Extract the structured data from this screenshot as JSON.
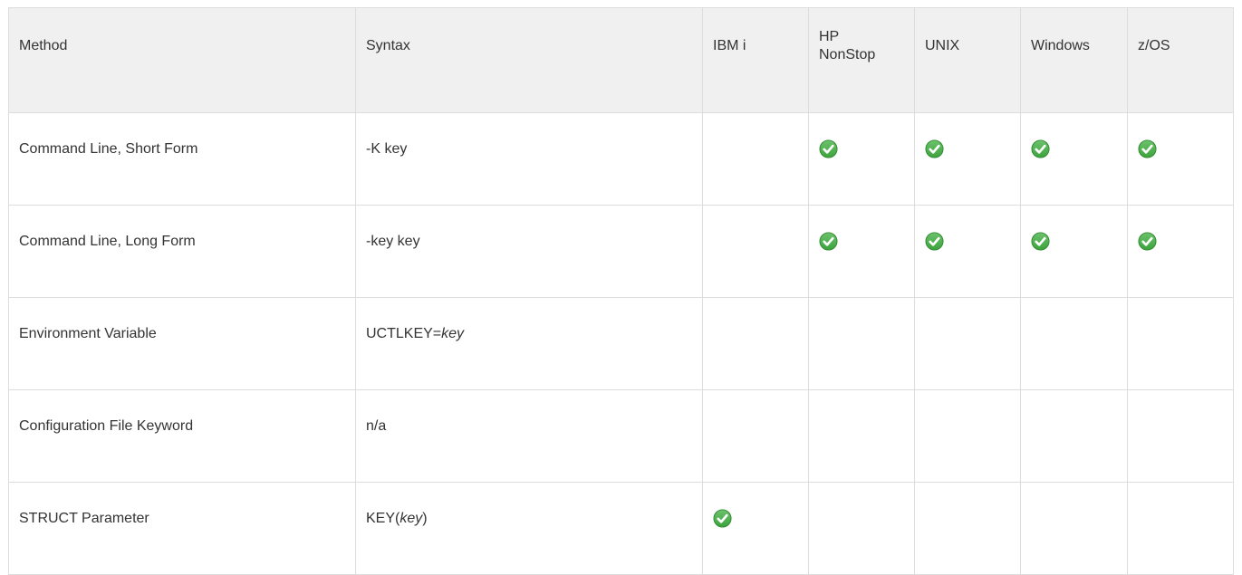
{
  "table": {
    "headers": [
      "Method",
      "Syntax",
      "IBM i",
      "HP NonStop",
      "UNIX",
      "Windows",
      "z/OS"
    ],
    "header_hp_line1": "HP",
    "header_hp_line2": "NonStop",
    "rows": [
      {
        "method": "Command Line, Short Form",
        "syntax_pre": "-K key",
        "syntax_em": "",
        "syntax_post": "",
        "support": [
          false,
          true,
          true,
          true,
          true
        ]
      },
      {
        "method": "Command Line, Long Form",
        "syntax_pre": "-key key",
        "syntax_em": "",
        "syntax_post": "",
        "support": [
          false,
          true,
          true,
          true,
          true
        ]
      },
      {
        "method": "Environment Variable",
        "syntax_pre": "UCTLKEY=",
        "syntax_em": "key",
        "syntax_post": "",
        "support": [
          false,
          false,
          false,
          false,
          false
        ]
      },
      {
        "method": "Configuration File Keyword",
        "syntax_pre": "n/a",
        "syntax_em": "",
        "syntax_post": "",
        "support": [
          false,
          false,
          false,
          false,
          false
        ]
      },
      {
        "method": "STRUCT Parameter",
        "syntax_pre": "KEY(",
        "syntax_em": "key",
        "syntax_post": ")",
        "support": [
          true,
          false,
          false,
          false,
          false
        ]
      }
    ]
  },
  "icons": {
    "supported": "check-circle-icon"
  },
  "colors": {
    "check_fill": "#3ca33c",
    "check_border": "#2f8a2f",
    "header_bg": "#f0f0f0",
    "border": "#dddddd"
  }
}
